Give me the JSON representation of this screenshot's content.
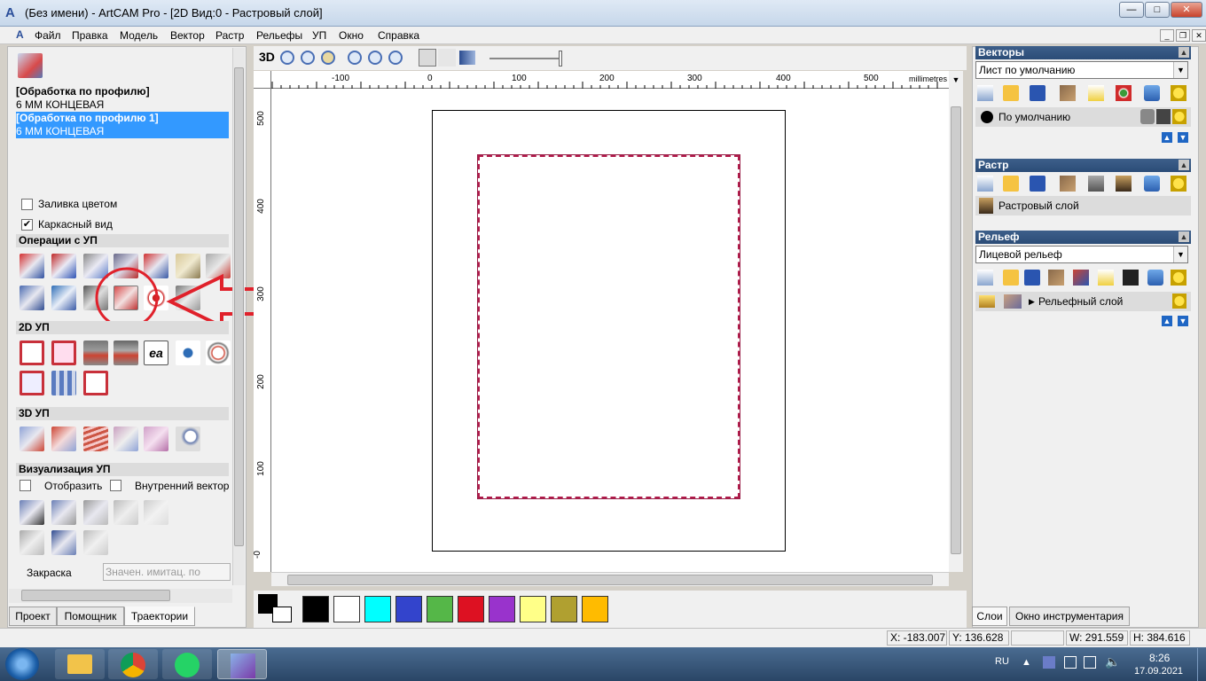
{
  "window": {
    "title": "(Без имени) - ArtCAM Pro - [2D Вид:0 - Растровый слой]",
    "controls": {
      "minimize": "—",
      "maximize": "□",
      "close": "✕"
    }
  },
  "menu": [
    "Файл",
    "Правка",
    "Модель",
    "Вектор",
    "Растр",
    "Рельефы",
    "УП",
    "Окно",
    "Справка"
  ],
  "left_panel": {
    "toolpaths": [
      {
        "name": "[Обработка по профилю]",
        "tool": "6 ММ КОНЦЕВАЯ",
        "selected": false
      },
      {
        "name": "[Обработка по профилю 1]",
        "tool": "6 ММ КОНЦЕВАЯ",
        "selected": true
      }
    ],
    "fill_color_label": "Заливка цветом",
    "fill_color_checked": false,
    "wireframe_label": "Каркасный вид",
    "wireframe_checked": true,
    "sections": {
      "ops": "Операции с УП",
      "toolpaths_2d": "2D УП",
      "toolpaths_3d": "3D УП",
      "simulation": "Визуализация УП"
    },
    "display_label": "Отобразить",
    "display_checked": false,
    "inner_vector_label": "Внутренний вектор",
    "inner_vector_checked": false,
    "shading_label": "Закраска",
    "shading_placeholder": "Значен. имитац. по",
    "tabs": [
      "Проект",
      "Помощник",
      "Траектории"
    ],
    "active_tab": "Траектории"
  },
  "toolbar_2d": {
    "view3d": "3D"
  },
  "ruler": {
    "units": "millimetres",
    "top_ticks": [
      "-100",
      "0",
      "100",
      "200",
      "300",
      "400",
      "500"
    ],
    "left_ticks": [
      "500",
      "400",
      "300",
      "200",
      "100",
      "-0"
    ]
  },
  "palette": {
    "colors": [
      "#000000",
      "#ffffff",
      "#00ffff",
      "#3344cc",
      "#55b748",
      "#dd1122",
      "#9933cc",
      "#ffff88",
      "#b0a030",
      "#ffbb00"
    ]
  },
  "right_panel": {
    "vectors": {
      "title": "Векторы",
      "sheet": "Лист по умолчанию",
      "layer": "По умолчанию"
    },
    "bitmap": {
      "title": "Растр",
      "layer": "Растровый слой"
    },
    "relief": {
      "title": "Рельеф",
      "relief_name": "Лицевой рельеф",
      "layer": "Рельефный слой"
    },
    "tabs": [
      "Слои",
      "Окно инструментария"
    ],
    "active_tab": "Слои"
  },
  "status": {
    "x": "X: -183.007",
    "y": "Y: 136.628",
    "w": "W: 291.559",
    "h": "H: 384.616"
  },
  "taskbar": {
    "lang": "RU",
    "time": "8:26",
    "date": "17.09.2021"
  },
  "colors": {
    "accent": "#3399ff",
    "annotation_red": "#e0212b",
    "vector_outline": "#b01b4a"
  }
}
